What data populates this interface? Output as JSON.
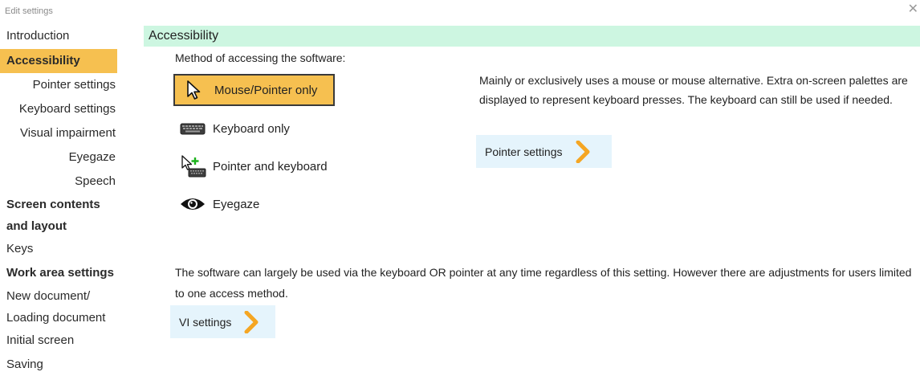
{
  "window": {
    "title": "Edit settings",
    "close_glyph": "✕"
  },
  "sidebar": {
    "items": [
      {
        "label": "Introduction"
      },
      {
        "label": "Accessibility",
        "selected": true
      },
      {
        "label": "Pointer settings"
      },
      {
        "label": "Keyboard settings"
      },
      {
        "label": "Visual impairment"
      },
      {
        "label": "Eyegaze"
      },
      {
        "label": "Speech"
      },
      {
        "label_line1": "Screen contents",
        "label_line2": "and layout"
      },
      {
        "label": "Keys"
      },
      {
        "label": "Work area settings"
      },
      {
        "label_line1": "New document/",
        "label_line2": "Loading document"
      },
      {
        "label": "Initial screen"
      },
      {
        "label": "Saving"
      }
    ]
  },
  "main": {
    "section_title": "Accessibility",
    "method_label": "Method of accessing the software:",
    "options": [
      {
        "label": "Mouse/Pointer only",
        "icon": "mouse-pointer-icon",
        "selected": true
      },
      {
        "label": "Keyboard only",
        "icon": "keyboard-icon"
      },
      {
        "label": "Pointer and keyboard",
        "icon": "pointer-keyboard-icon"
      },
      {
        "label": "Eyegaze",
        "icon": "eye-icon"
      }
    ],
    "description": "Mainly or exclusively uses a mouse or mouse alternative.  Extra on-screen palettes are displayed to represent keyboard presses.  The keyboard can still be used if needed.",
    "pointer_settings_button": "Pointer settings",
    "note": "The software can largely be used via the keyboard OR pointer at any time regardless of this setting.  However there are adjustments for users limited to one access method.",
    "vi_settings_button": "VI settings"
  },
  "colors": {
    "selected_bg": "#f6c050",
    "section_bar_bg": "#cdf6e1",
    "nav_button_bg": "#e5f4fc",
    "arrow": "#f5a623"
  }
}
